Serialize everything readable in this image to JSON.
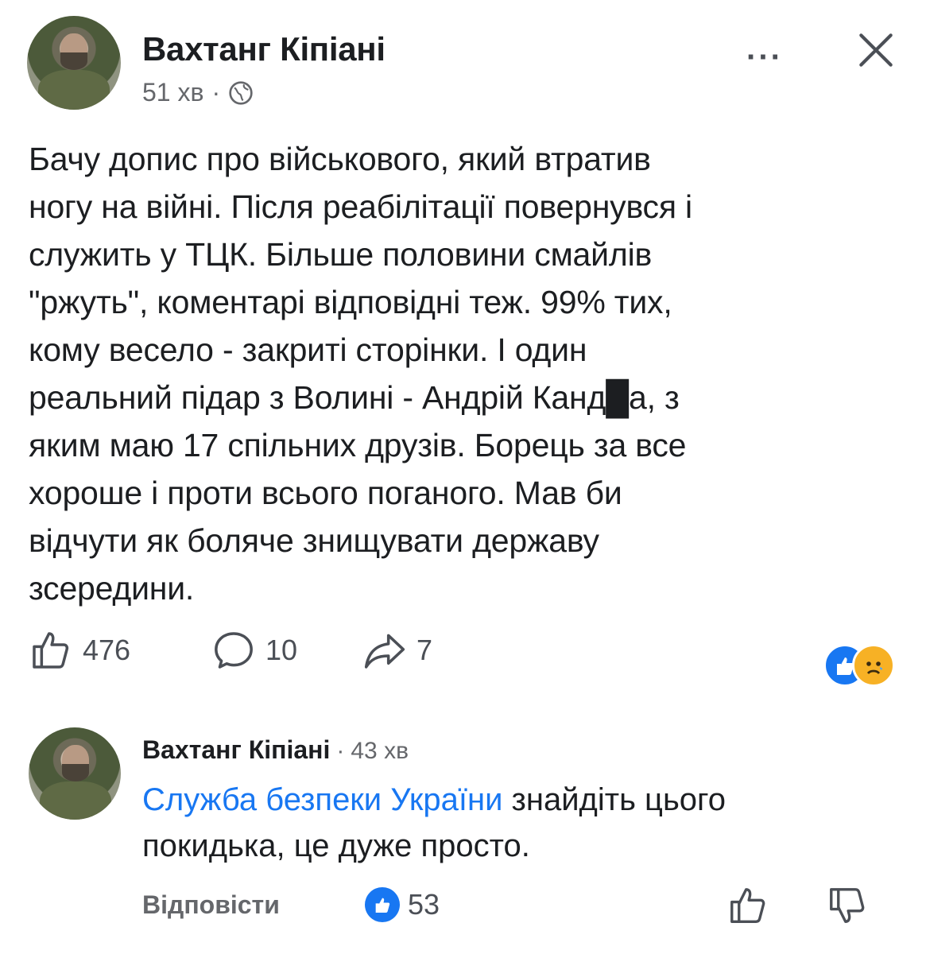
{
  "post": {
    "author": "Вахтанг Кіпіані",
    "time": "51 хв",
    "separator": "·",
    "more": "···",
    "text": "Бачу допис про військового, який втратив\nногу на війні. Після реабілітації повернувся і\nслужить у ТЦК. Більше половини смайлів\n\"ржуть\", коментарі відповідні теж. 99% тих,\nкому весело - закриті сторінки. І один\nреальний підар з Волині - Андрій Канд█а, з\nяким маю 17 спільних друзів. Борець за все\nхороше і проти всього поганого. Мав би\nвідчути як боляче знищувати державу\nзсередини.",
    "likes": "476",
    "comments": "10",
    "shares": "7",
    "reaction_icons": [
      "like-reaction",
      "sad-reaction"
    ]
  },
  "comment": {
    "author": "Вахтанг Кіпіані",
    "separator": "·",
    "time": "43 хв",
    "mention": "Служба безпеки України",
    "text_after_mention": " знайдіть цього покидька, це дуже просто.",
    "reply_label": "Відповісти",
    "likes": "53"
  },
  "colors": {
    "link": "#1877f2",
    "meta": "#65676b",
    "sad": "#f7b125"
  }
}
